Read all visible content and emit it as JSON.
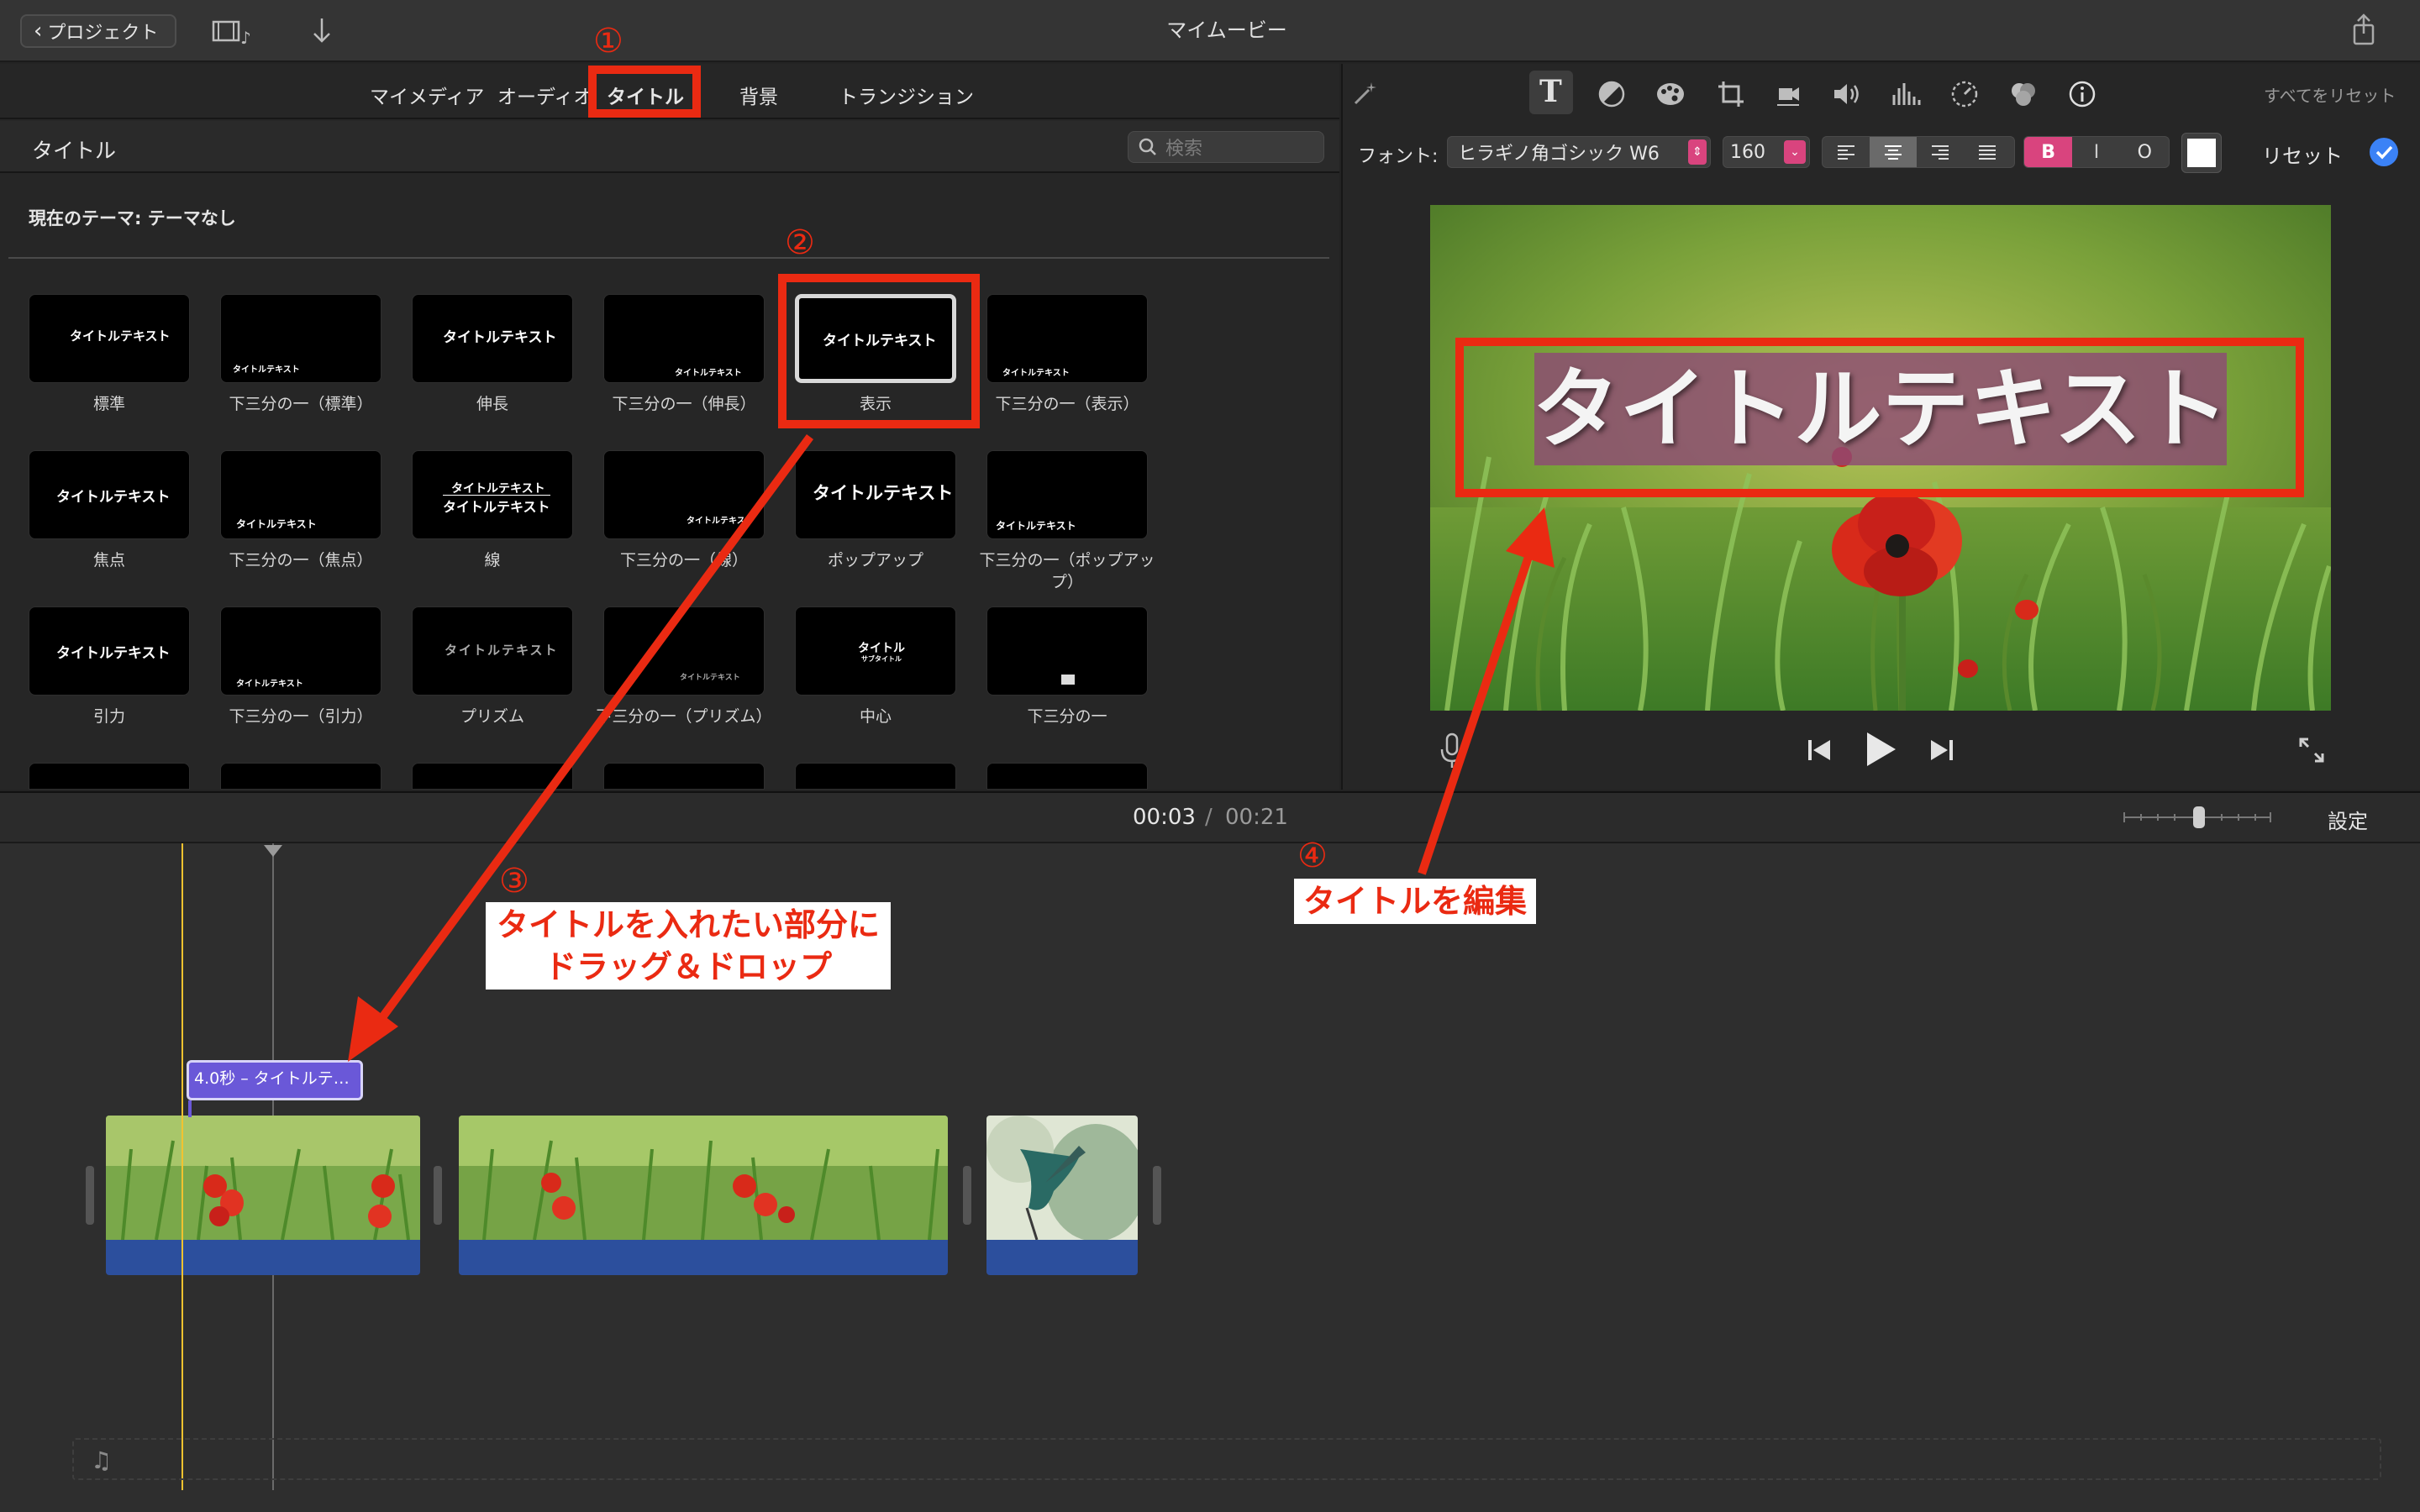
{
  "topbar": {
    "back_label": "プロジェクト",
    "title": "マイムービー"
  },
  "browser": {
    "tabs": [
      "マイメディア",
      "オーディオ",
      "タイトル",
      "背景",
      "トランジション"
    ],
    "active_tab": "タイトル",
    "section_title": "タイトル",
    "search_placeholder": "検索",
    "theme_label": "現在のテーマ: テーマなし",
    "thumb_text": "タイトルテキスト",
    "titles": [
      {
        "label": "標準"
      },
      {
        "label": "下三分の一（標準）"
      },
      {
        "label": "伸長"
      },
      {
        "label": "下三分の一（伸長）"
      },
      {
        "label": "表示"
      },
      {
        "label": "下三分の一（表示）"
      },
      {
        "label": "焦点"
      },
      {
        "label": "下三分の一（焦点）"
      },
      {
        "label": "線"
      },
      {
        "label": "下三分の一（線）"
      },
      {
        "label": "ポップアップ"
      },
      {
        "label": "下三分の一（ポップアップ）"
      },
      {
        "label": "引力"
      },
      {
        "label": "下三分の一（引力）"
      },
      {
        "label": "プリズム"
      },
      {
        "label": "下三分の一（プリズム）"
      },
      {
        "label": "中心"
      },
      {
        "label": "下三分の一"
      }
    ],
    "center_thumb": "タイトル",
    "center_thumb_sub": "サブタイトル"
  },
  "viewer": {
    "reset_all": "すべてをリセット",
    "font_label": "フォント:",
    "font_value": "ヒラギノ角ゴシック W6",
    "size_value": "160",
    "bold": "B",
    "italic": "I",
    "outline": "O",
    "reset": "リセット",
    "title_text": "タイトルテキスト",
    "colors": {
      "accent": "#3b82f6",
      "style_active": "#d9447e"
    }
  },
  "timeline": {
    "current_time": "00:03",
    "separator": "/",
    "total_time": "00:21",
    "settings": "設定",
    "title_clip": "4.0秒 – タイトルテ…"
  },
  "annotations": {
    "n1": "①",
    "n2": "②",
    "n3": "③",
    "n4": "④",
    "drag_line1": "タイトルを入れたい部分に",
    "drag_line2": "ドラッグ＆ドロップ",
    "edit": "タイトルを編集",
    "color": "#ea2a12"
  }
}
